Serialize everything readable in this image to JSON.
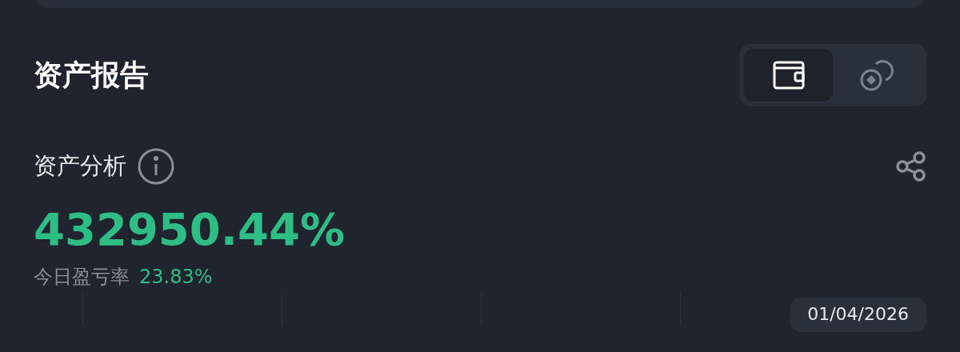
{
  "title": "资产报告",
  "view_toggle": [
    {
      "kind": "wallet",
      "selected": true
    },
    {
      "kind": "coins",
      "selected": false
    }
  ],
  "analysis": {
    "title": "资产分析",
    "value": "432950.44%",
    "today_label": "今日盈亏率",
    "today_value": "23.83%"
  },
  "chart": {
    "date": "01/04/2026"
  }
}
